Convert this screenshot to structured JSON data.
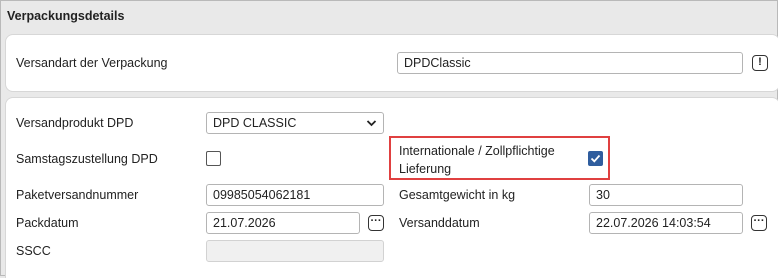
{
  "section": {
    "title": "Verpackungsdetails"
  },
  "shipping_method": {
    "label": "Versandart der Verpackung",
    "value": "DPDClassic"
  },
  "fields": {
    "versandprodukt": {
      "label": "Versandprodukt DPD",
      "value": "DPD CLASSIC"
    },
    "samstag": {
      "label": "Samstagszustellung DPD",
      "checked": false
    },
    "international": {
      "label_line1": "Internationale / Zollpflichtige",
      "label_line2": "Lieferung",
      "checked": true
    },
    "paketnummer": {
      "label": "Paketversandnummer",
      "value": "09985054062181"
    },
    "gewicht": {
      "label": "Gesamtgewicht in kg",
      "value": "30"
    },
    "packdatum": {
      "label": "Packdatum",
      "value": "21.07.2026"
    },
    "versanddatum": {
      "label": "Versanddatum",
      "value": "22.07.2026 14:03:54"
    },
    "sscc": {
      "label": "SSCC",
      "value": ""
    }
  },
  "icons": {
    "info": "exclamation-icon",
    "date_picker": "ellipsis-icon",
    "select": "chevron-down-icon",
    "check": "checkmark-icon"
  },
  "colors": {
    "highlight_border": "#e04040",
    "checkbox_checked": "#2f5d9e"
  }
}
